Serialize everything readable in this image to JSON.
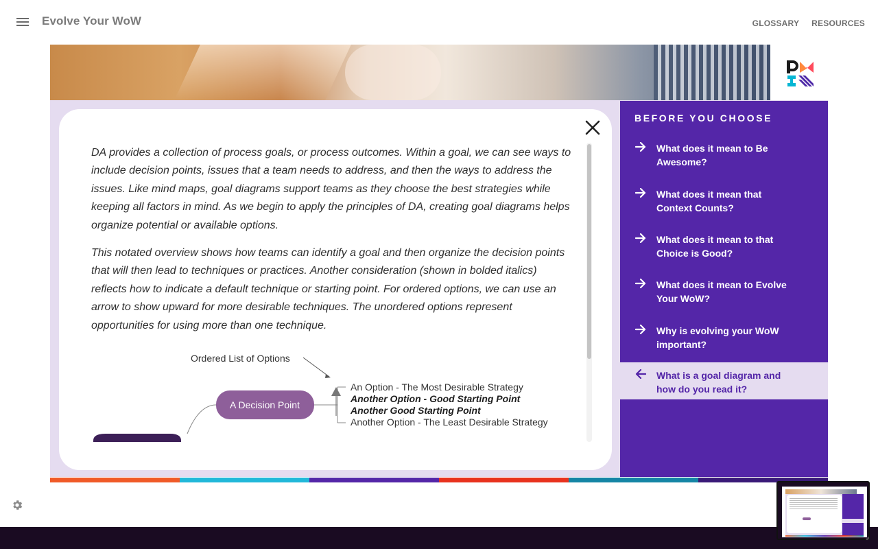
{
  "app": {
    "title": "Evolve Your WoW"
  },
  "topnav": [
    {
      "label": "GLOSSARY"
    },
    {
      "label": "RESOURCES"
    }
  ],
  "card": {
    "paragraphs": [
      "DA provides a collection of process goals, or process outcomes. Within a goal, we can see ways to include decision points, issues that a team needs to address, and then the ways to address the issues. Like mind maps, goal diagrams support teams as they choose the best strategies while keeping all factors in mind. As we begin to apply the principles of DA, creating goal diagrams helps organize potential or available options.",
      "This notated overview shows how teams can identify a goal and then organize the decision points that will then lead to techniques or practices. Another consideration (shown in bolded italics) reflects how to indicate a default technique or starting point. For ordered options, we can use an arrow to show upward for more desirable techniques. The unordered options represent opportunities for using more than one technique."
    ],
    "diagram": {
      "annotation": "Ordered List of Options",
      "decision_point": "A Decision Point",
      "options": [
        {
          "label": "An Option - The Most Desirable Strategy",
          "style": "normal"
        },
        {
          "label": "Another Option - Good Starting Point",
          "style": "bold-italic"
        },
        {
          "label": "Another Good Starting Point",
          "style": "bold-italic"
        },
        {
          "label": "Another Option - The Least Desirable Strategy",
          "style": "normal"
        }
      ]
    },
    "scroll_fraction_visible": 0.72
  },
  "sidebar": {
    "title": "BEFORE YOU CHOOSE",
    "items": [
      {
        "label": "What does it mean to Be Awesome?",
        "icon": "arrow-right-icon",
        "active": false
      },
      {
        "label": "What does it mean that Context Counts?",
        "icon": "arrow-right-icon",
        "active": false
      },
      {
        "label": "What does it mean to that Choice is Good?",
        "icon": "arrow-right-icon",
        "active": false
      },
      {
        "label": "What does it mean to Evolve Your WoW?",
        "icon": "arrow-right-icon",
        "active": false
      },
      {
        "label": "Why is evolving your WoW important?",
        "icon": "arrow-right-icon",
        "active": false
      },
      {
        "label": "What is a goal diagram and how do you read it?",
        "icon": "arrow-left-icon",
        "active": true
      }
    ]
  },
  "colors": {
    "brand_purple": "#5426a8",
    "lavender": "#e5dcf0",
    "decision_node": "#8e5f9a",
    "stripe": [
      "#f05a28",
      "#21b8d9",
      "#5426a8",
      "#e8321e",
      "#1585a5",
      "#3a1a78"
    ]
  },
  "icons": {
    "menu": "hamburger-icon",
    "close": "close-icon",
    "settings": "gear-icon",
    "resize": "resize-handle-icon"
  }
}
